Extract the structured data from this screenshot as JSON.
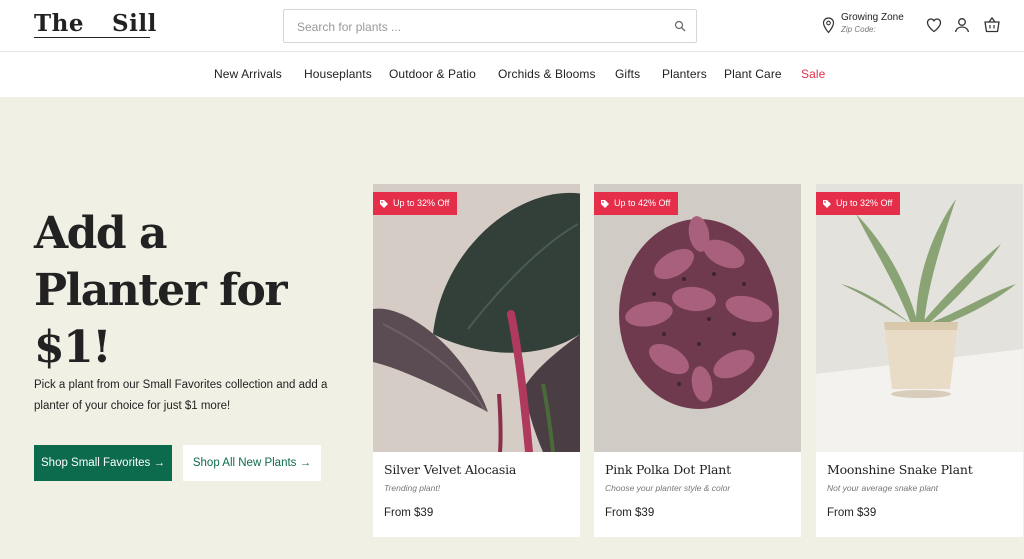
{
  "header": {
    "logo_left": "The",
    "logo_right": "Sill",
    "search_placeholder": "Search for plants ...",
    "growing_zone_label": "Growing Zone",
    "zip_code_label": "Zip Code:"
  },
  "nav": {
    "items": [
      "New Arrivals",
      "Houseplants",
      "Outdoor & Patio",
      "Orchids & Blooms",
      "Gifts",
      "Planters",
      "Plant Care",
      "Sale"
    ]
  },
  "hero": {
    "headline": "Add a Planter for $1!",
    "description": "Pick a plant from our Small Favorites collection and add a planter of your choice for just $1 more!",
    "primary_button": "Shop Small Favorites →",
    "secondary_button": "Shop All New Plants →"
  },
  "products": [
    {
      "badge": "Up to 32% Off",
      "name": "Silver Velvet Alocasia",
      "tagline": "Trending plant!",
      "price": "From $39"
    },
    {
      "badge": "Up to 42% Off",
      "name": "Pink Polka Dot Plant",
      "tagline": "Choose your planter style & color",
      "price": "From $39"
    },
    {
      "badge": "Up to 32% Off",
      "name": "Moonshine Snake Plant",
      "tagline": "Not your average snake plant",
      "price": "From $39"
    }
  ],
  "colors": {
    "brand_green": "#0d6b4d",
    "sale_red": "#e52f4a",
    "hero_bg": "#f1f0e5"
  },
  "icons": [
    "search-icon",
    "location-pin-icon",
    "heart-icon",
    "user-icon",
    "cart-icon",
    "tag-icon"
  ]
}
